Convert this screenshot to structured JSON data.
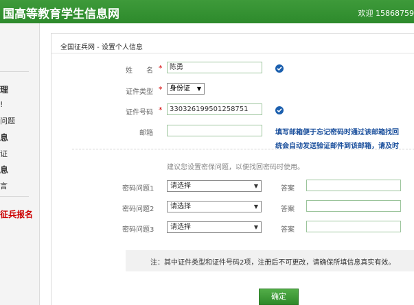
{
  "header": {
    "site_title": "国高等教育学生信息网",
    "welcome": "欢迎 15868759"
  },
  "sidebar": {
    "items": [
      {
        "label": "理",
        "style": "bold"
      },
      {
        "label": "!",
        "style": "normal"
      },
      {
        "label": "问题",
        "style": "normal"
      },
      {
        "label": "息",
        "style": "bold"
      },
      {
        "label": "证",
        "style": "normal"
      },
      {
        "label": "息",
        "style": "bold"
      },
      {
        "label": "言",
        "style": "normal"
      },
      {
        "label": "征兵报名",
        "style": "red"
      }
    ]
  },
  "breadcrumb": "全国征兵网 - 设置个人信息",
  "form": {
    "name": {
      "label": "姓　　名",
      "value": "陈勇"
    },
    "id_type": {
      "label": "证件类型",
      "value": "身份证"
    },
    "id_number": {
      "label": "证件号码",
      "value": "330326199501258751"
    },
    "email": {
      "label": "邮箱",
      "value": ""
    },
    "email_hint_line1": "填写邮箱便于忘记密码时通过该邮箱找回",
    "email_hint_line2": "统会自动发送验证邮件到该邮箱，请及时"
  },
  "security": {
    "suggest": "建议您设置密保问题，以便找回密码时使用。",
    "questions": [
      {
        "label": "密码问题1",
        "select_value": "请选择",
        "answer_label": "答案",
        "answer_value": ""
      },
      {
        "label": "密码问题2",
        "select_value": "请选择",
        "answer_label": "答案",
        "answer_value": ""
      },
      {
        "label": "密码问题3",
        "select_value": "请选择",
        "answer_label": "答案",
        "answer_value": ""
      }
    ]
  },
  "note": "注：其中证件类型和证件号码2项，注册后不可更改，请确保所填信息真实有效。",
  "confirm_label": "确定",
  "required_mark": "*",
  "dropdown_arrow": "▼",
  "colors": {
    "header_green": "#2d8a2c",
    "check_blue": "#1b5fae",
    "hint_blue": "#1a4f9c",
    "required_red": "#d40000",
    "sidebar_red": "#cc0000"
  }
}
